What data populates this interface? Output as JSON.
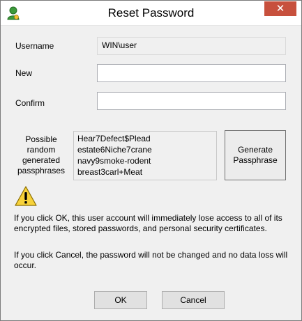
{
  "window": {
    "title": "Reset Password",
    "close_glyph": "✕"
  },
  "form": {
    "username_label": "Username",
    "username_value": "WIN\\user",
    "new_label": "New",
    "new_value": "",
    "confirm_label": "Confirm",
    "confirm_value": ""
  },
  "passphrases": {
    "label_lines": [
      "Possible",
      "random",
      "generated",
      "passphrases"
    ],
    "items": [
      "Hear7Defect$Plead",
      "estate6Niche7crane",
      "navy9smoke-rodent",
      "breast3carl+Meat"
    ],
    "generate_label_lines": [
      "Generate",
      "Passphrase"
    ]
  },
  "messages": {
    "ok_warning": "If you click OK, this user account will immediately lose access to all of its encrypted files, stored passwords, and personal security certificates.",
    "cancel_note": "If you click Cancel, the password will not be changed and no data loss will occur."
  },
  "buttons": {
    "ok_label": "OK",
    "cancel_label": "Cancel"
  },
  "icons": {
    "title_icon": "user-icon",
    "warning_icon": "warning-icon",
    "close_icon": "close-icon"
  },
  "colors": {
    "close_button": "#c7503d",
    "dialog_background": "#f0f0f0",
    "warning_yellow": "#f7d23a",
    "user_icon_green": "#3c9a3a"
  }
}
